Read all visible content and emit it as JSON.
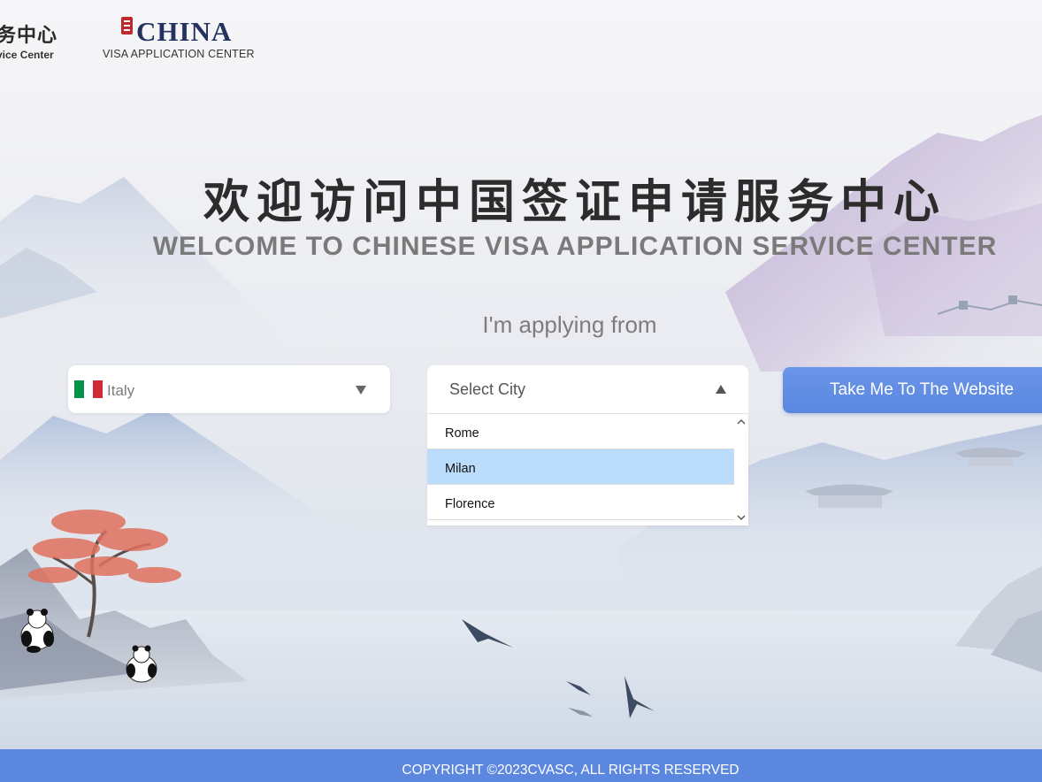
{
  "header": {
    "left_logo_cn": "务中心",
    "left_logo_en": "vice  Center",
    "right_logo_title": "CHINA",
    "right_logo_subtitle": "VISA APPLICATION CENTER"
  },
  "hero": {
    "title_cn": "欢迎访问中国签证申请服务中心",
    "title_en": "WELCOME TO CHINESE VISA APPLICATION SERVICE CENTER",
    "applying_from": "I'm applying from"
  },
  "country_select": {
    "value": "Italy",
    "flag_colors": [
      "#009246",
      "#ffffff",
      "#ce2b37"
    ],
    "icon": "chevron-down-icon"
  },
  "city_select": {
    "placeholder": "Select City",
    "icon": "chevron-up-icon",
    "expanded": true,
    "options": [
      {
        "label": "Rome",
        "highlighted": false
      },
      {
        "label": "Milan",
        "highlighted": true
      },
      {
        "label": "Florence",
        "highlighted": false
      }
    ]
  },
  "cta": {
    "label": "Take Me To The Website"
  },
  "footer": {
    "copyright": "COPYRIGHT ©2023CVASC, ALL RIGHTS RESERVED"
  },
  "colors": {
    "primary_button": "#5b87df",
    "highlight_option": "#bcdcfc",
    "footer_bg": "#5b87df"
  }
}
